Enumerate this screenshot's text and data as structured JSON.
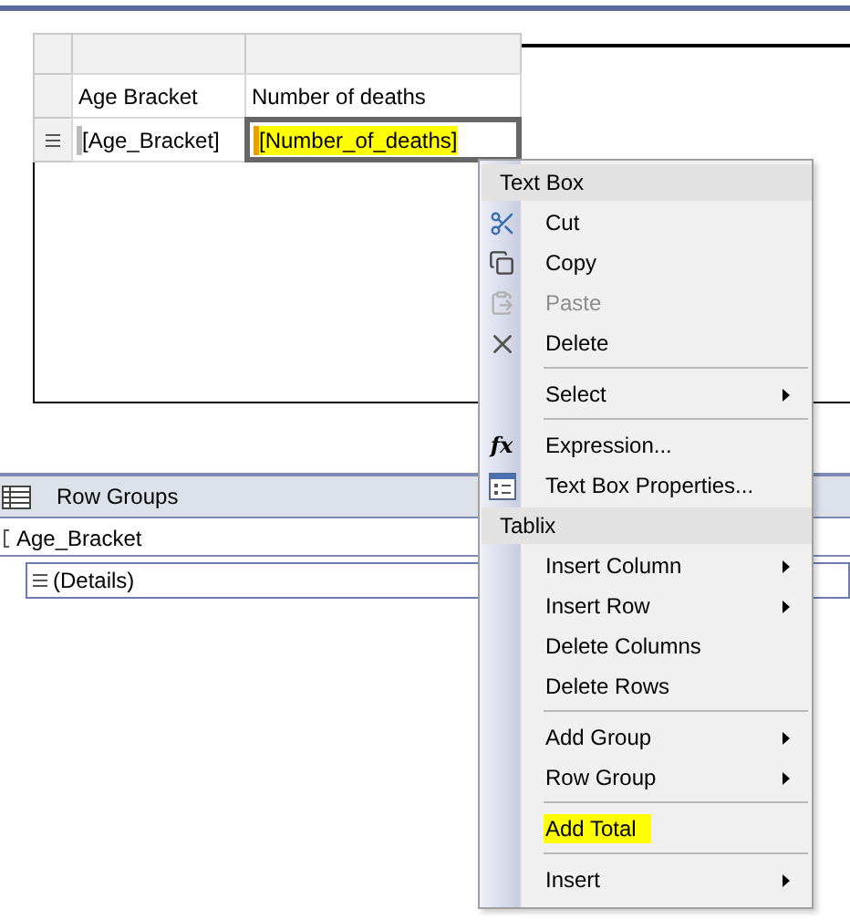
{
  "tablix": {
    "header_row": [
      "Age Bracket",
      "Number of deaths"
    ],
    "data_row": [
      {
        "text": "[Age_Bracket]",
        "selected": false,
        "highlighted": false
      },
      {
        "text": "[Number_of_deaths]",
        "selected": true,
        "highlighted": true
      }
    ]
  },
  "row_groups": {
    "title": "Row Groups",
    "groups": [
      {
        "label": "Age_Bracket",
        "children": [
          {
            "label": "(Details)"
          }
        ]
      }
    ]
  },
  "context_menu": [
    {
      "kind": "header",
      "label": "Text Box"
    },
    {
      "kind": "item",
      "label": "Cut",
      "disabled": false,
      "submenu": false,
      "highlighted": false
    },
    {
      "kind": "item",
      "label": "Copy",
      "disabled": false,
      "submenu": false,
      "highlighted": false
    },
    {
      "kind": "item",
      "label": "Paste",
      "disabled": true,
      "submenu": false,
      "highlighted": false
    },
    {
      "kind": "item",
      "label": "Delete",
      "disabled": false,
      "submenu": false,
      "highlighted": false
    },
    {
      "kind": "separator"
    },
    {
      "kind": "item",
      "label": "Select",
      "disabled": false,
      "submenu": true,
      "highlighted": false
    },
    {
      "kind": "separator"
    },
    {
      "kind": "item",
      "label": "Expression...",
      "glyph": "fx",
      "disabled": false,
      "submenu": false,
      "highlighted": false
    },
    {
      "kind": "item",
      "label": "Text Box Properties...",
      "disabled": false,
      "submenu": false,
      "highlighted": false
    },
    {
      "kind": "header",
      "label": "Tablix"
    },
    {
      "kind": "item",
      "label": "Insert Column",
      "disabled": false,
      "submenu": true,
      "highlighted": false
    },
    {
      "kind": "item",
      "label": "Insert Row",
      "disabled": false,
      "submenu": true,
      "highlighted": false
    },
    {
      "kind": "item",
      "label": "Delete Columns",
      "disabled": false,
      "submenu": false,
      "highlighted": false
    },
    {
      "kind": "item",
      "label": "Delete Rows",
      "disabled": false,
      "submenu": false,
      "highlighted": false
    },
    {
      "kind": "separator"
    },
    {
      "kind": "item",
      "label": "Add Group",
      "disabled": false,
      "submenu": true,
      "highlighted": false
    },
    {
      "kind": "item",
      "label": "Row Group",
      "disabled": false,
      "submenu": true,
      "highlighted": false
    },
    {
      "kind": "separator"
    },
    {
      "kind": "item",
      "label": "Add Total",
      "disabled": false,
      "submenu": false,
      "highlighted": true
    },
    {
      "kind": "separator"
    },
    {
      "kind": "item",
      "label": "Insert",
      "disabled": false,
      "submenu": true,
      "highlighted": false
    }
  ]
}
